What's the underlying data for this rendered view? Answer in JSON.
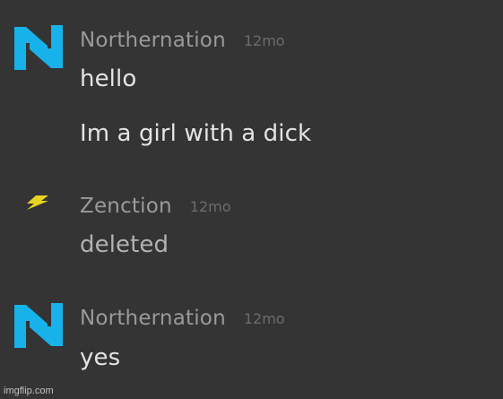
{
  "messages": [
    {
      "username": "Northernation",
      "time": "12mo",
      "avatar_icon": "blue-n-logo-icon",
      "avatar_color": "#17b2ea",
      "lines": [
        "hello",
        "Im a girl with a dick"
      ]
    },
    {
      "username": "Zenction",
      "time": "12mo",
      "avatar_icon": "yellow-lightning-icon",
      "avatar_color": "#e8d321",
      "lines": [
        "deleted"
      ]
    },
    {
      "username": "Northernation",
      "time": "12mo",
      "avatar_icon": "blue-n-logo-icon",
      "avatar_color": "#17b2ea",
      "lines": [
        "yes"
      ]
    }
  ],
  "watermark": "imgflip.com"
}
